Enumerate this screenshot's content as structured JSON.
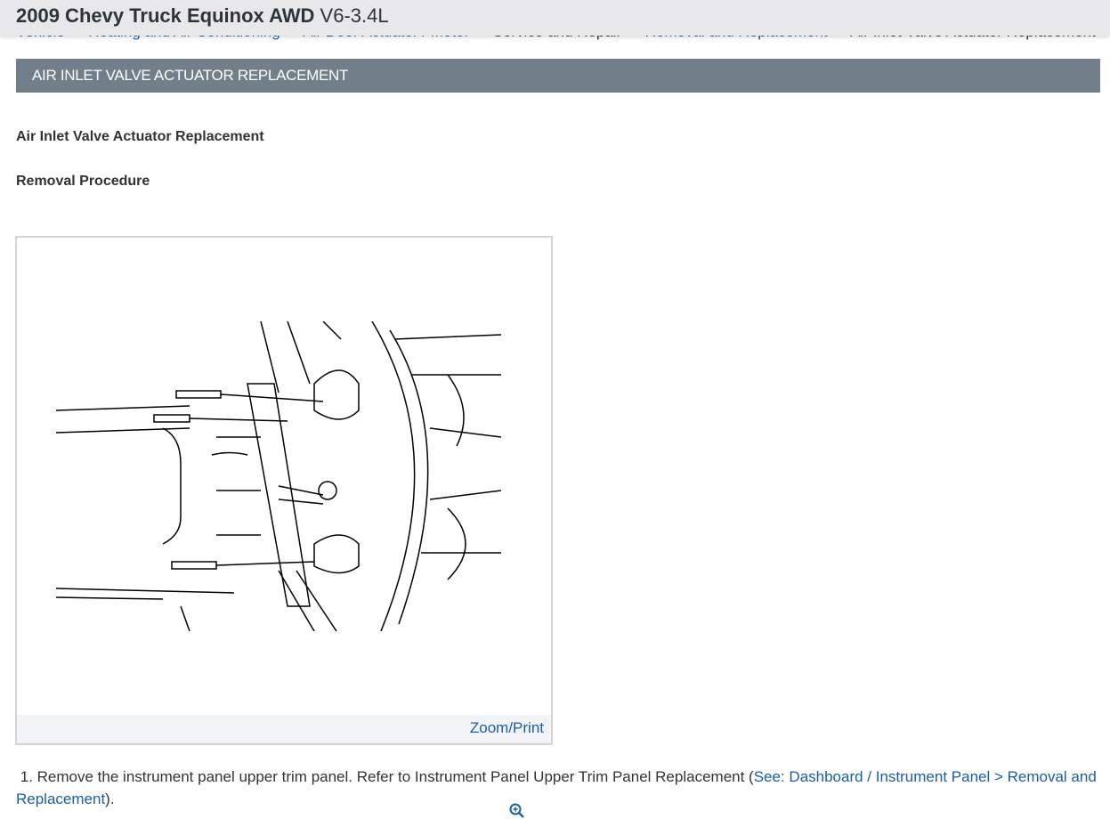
{
  "header": {
    "title": "2009 Chevy Truck Equinox AWD",
    "engine": "V6-3.4L"
  },
  "breadcrumb": [
    "Vehicle",
    "Heating and Air Conditioning",
    "Air Door Actuator / Motor",
    "Service and Repair",
    "Removal and Replacement",
    "Air Inlet Valve Actuator Replacement"
  ],
  "banner": "AIR INLET VALVE ACTUATOR REPLACEMENT",
  "heading": "Air Inlet Valve Actuator Replacement",
  "subheading": "Removal Procedure",
  "figure": {
    "zoom_label": "Zoom/Print",
    "zoom_icon": "zoom-in-icon"
  },
  "steps": [
    {
      "number": "1.",
      "text": "Remove the instrument panel upper trim panel. Refer to Instrument Panel Upper Trim Panel Replacement (",
      "link": "See: Dashboard / Instrument Panel > Removal and Replacement",
      "after": ")."
    }
  ]
}
